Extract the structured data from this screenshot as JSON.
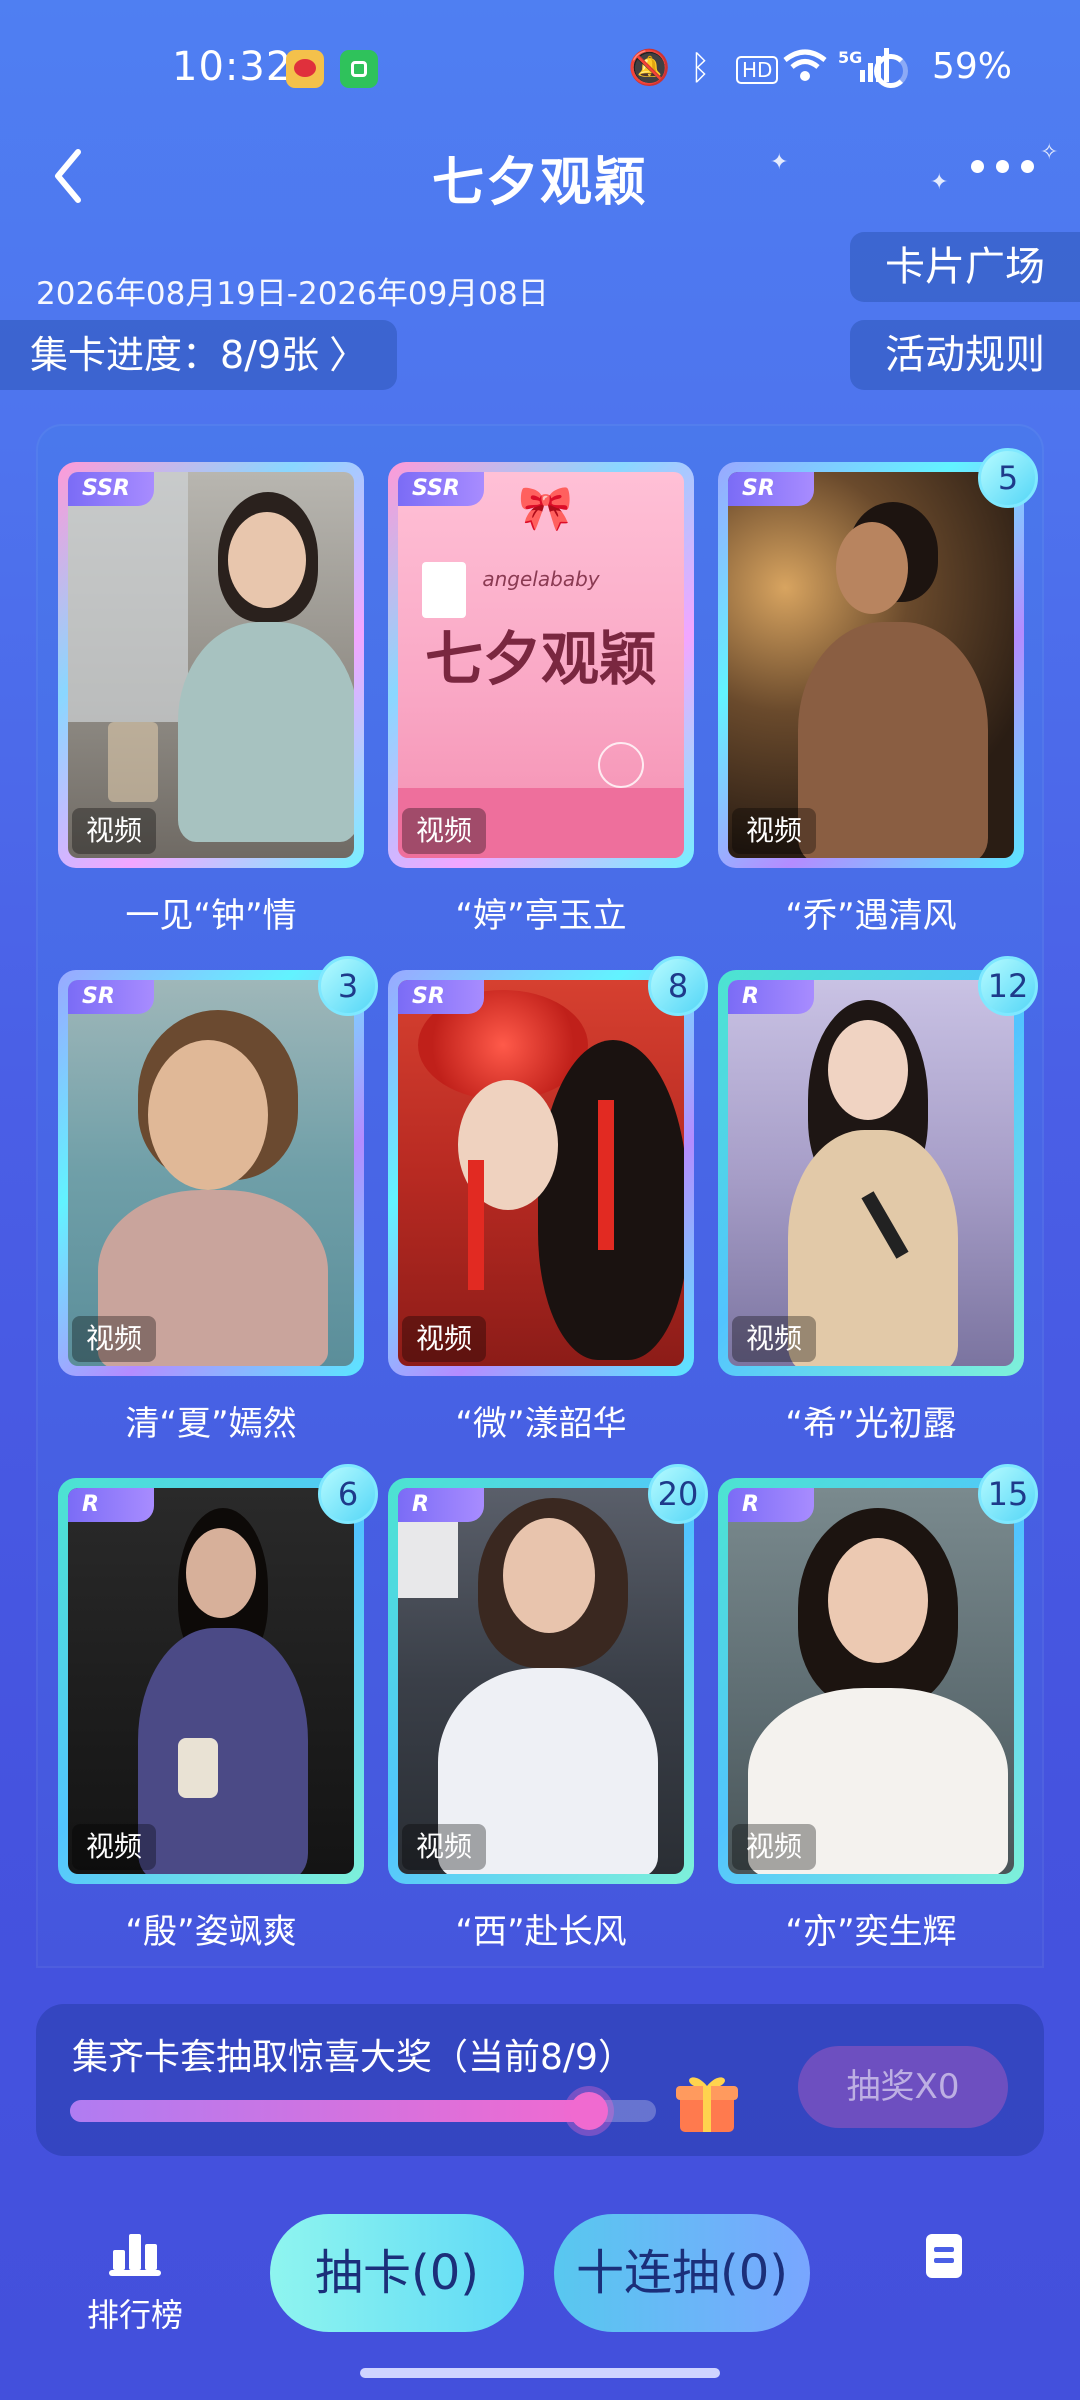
{
  "status_bar": {
    "time": "10:32",
    "battery": "59%",
    "net": "5G",
    "hd": "HD"
  },
  "header": {
    "title": "七夕观颖"
  },
  "event": {
    "date_range": "2026年08月19日-2026年09月08日",
    "progress_label": "集卡进度：8/9张",
    "plaza_label": "卡片广场",
    "rules_label": "活动规则"
  },
  "cards": [
    {
      "rarity": "SSR",
      "tag": "视频",
      "caption": "一见“钟”情",
      "count": ""
    },
    {
      "rarity": "SSR",
      "tag": "视频",
      "caption": "“婷”亭玉立",
      "count": "",
      "poster_title": "七夕观颖",
      "poster_sub": "angelababy"
    },
    {
      "rarity": "SR",
      "tag": "视频",
      "caption": "“乔”遇清风",
      "count": "5"
    },
    {
      "rarity": "SR",
      "tag": "视频",
      "caption": "清“夏”嫣然",
      "count": "3"
    },
    {
      "rarity": "SR",
      "tag": "视频",
      "caption": "“微”漾韶华",
      "count": "8"
    },
    {
      "rarity": "R",
      "tag": "视频",
      "caption": "“希”光初露",
      "count": "12"
    },
    {
      "rarity": "R",
      "tag": "视频",
      "caption": "“殷”姿飒爽",
      "count": "6"
    },
    {
      "rarity": "R",
      "tag": "视频",
      "caption": "“西”赴长风",
      "count": "20"
    },
    {
      "rarity": "R",
      "tag": "视频",
      "caption": "“亦”奕生辉",
      "count": "15"
    }
  ],
  "prize": {
    "title": "集齐卡套抽取惊喜大奖（当前8/9）",
    "progress": 0.89,
    "button": "抽奖X0"
  },
  "bottom_nav": {
    "rank_label": "排行榜",
    "draw_label": "抽卡(0)",
    "ten_draw_label": "十连抽(0)"
  }
}
